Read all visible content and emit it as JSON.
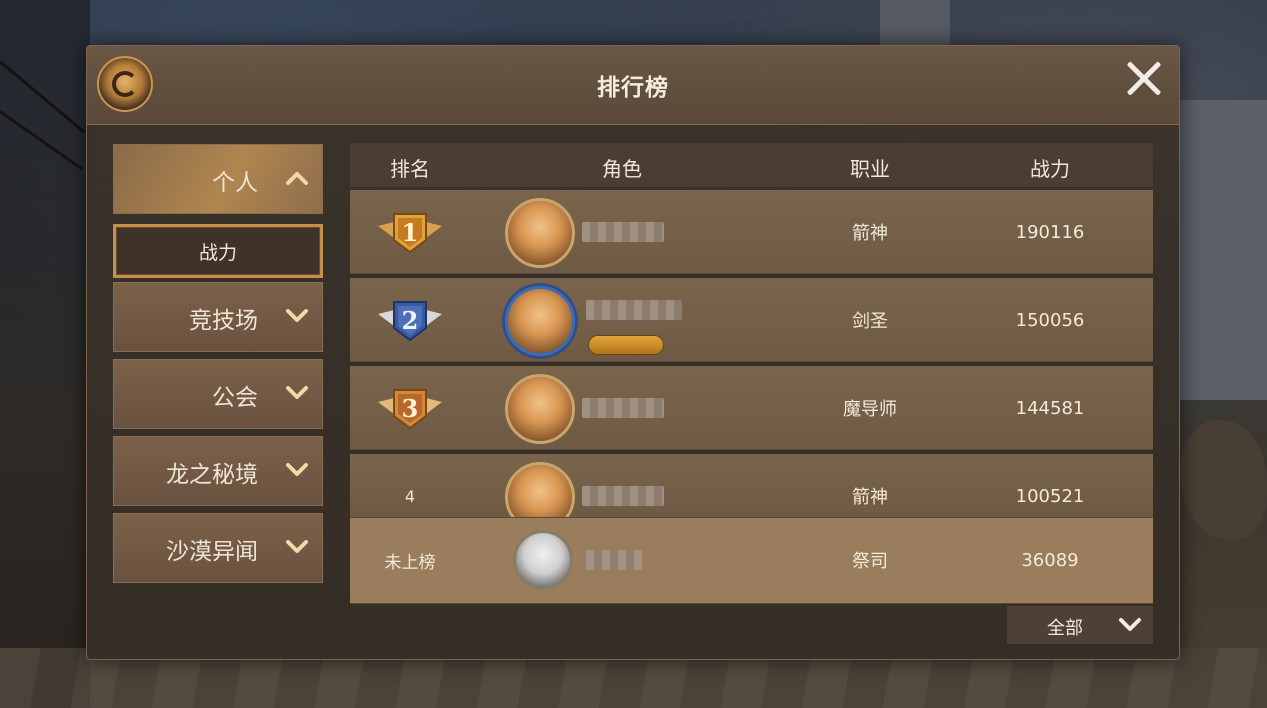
{
  "window": {
    "title": "排行榜"
  },
  "sidebar": {
    "items": [
      {
        "label": "个人",
        "expanded": true,
        "sub_items": [
          {
            "label": "战力",
            "selected": true
          }
        ]
      },
      {
        "label": "竞技场",
        "expanded": false
      },
      {
        "label": "公会",
        "expanded": false
      },
      {
        "label": "龙之秘境",
        "expanded": false
      },
      {
        "label": "沙漠异闻",
        "expanded": false
      }
    ]
  },
  "table": {
    "headers": {
      "rank": "排名",
      "role": "角色",
      "class": "职业",
      "power": "战力"
    },
    "rows": [
      {
        "rank": "1",
        "medal": "gold-medal-icon",
        "name": "",
        "class": "箭神",
        "power": "190116"
      },
      {
        "rank": "2",
        "medal": "silver-medal-icon",
        "name": "",
        "class": "剑圣",
        "power": "150056"
      },
      {
        "rank": "3",
        "medal": "bronze-medal-icon",
        "name": "",
        "class": "魔导师",
        "power": "144581"
      },
      {
        "rank": "4",
        "medal": "",
        "name": "",
        "class": "箭神",
        "power": "100521"
      }
    ],
    "self_row": {
      "rank": "未上榜",
      "name": "",
      "class": "祭司",
      "power": "36089"
    }
  },
  "filter": {
    "selected": "全部"
  },
  "colors": {
    "panel": "#3a322a",
    "accent": "#c58f4c",
    "text": "#f2ead9",
    "gold": "#e0a23c",
    "silver_badge": "#3a5aa0",
    "bronze": "#d4893a"
  }
}
